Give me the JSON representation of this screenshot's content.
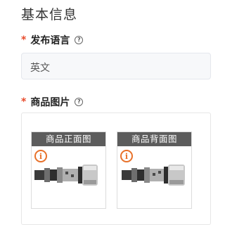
{
  "section": {
    "title": "基本信息"
  },
  "language_field": {
    "required_mark": "*",
    "label": "发布语言",
    "help_icon": "question-circle-icon",
    "value": "英文"
  },
  "image_field": {
    "required_mark": "*",
    "label": "商品图片",
    "help_icon": "question-circle-icon",
    "images": [
      {
        "caption": "商品正面图",
        "badge_icon": "info-icon"
      },
      {
        "caption": "商品背面图",
        "badge_icon": "info-icon"
      }
    ]
  },
  "colors": {
    "required": "#e84a2b",
    "info_badge": "#e8712a",
    "caption_bg": "#5c5c5c"
  }
}
